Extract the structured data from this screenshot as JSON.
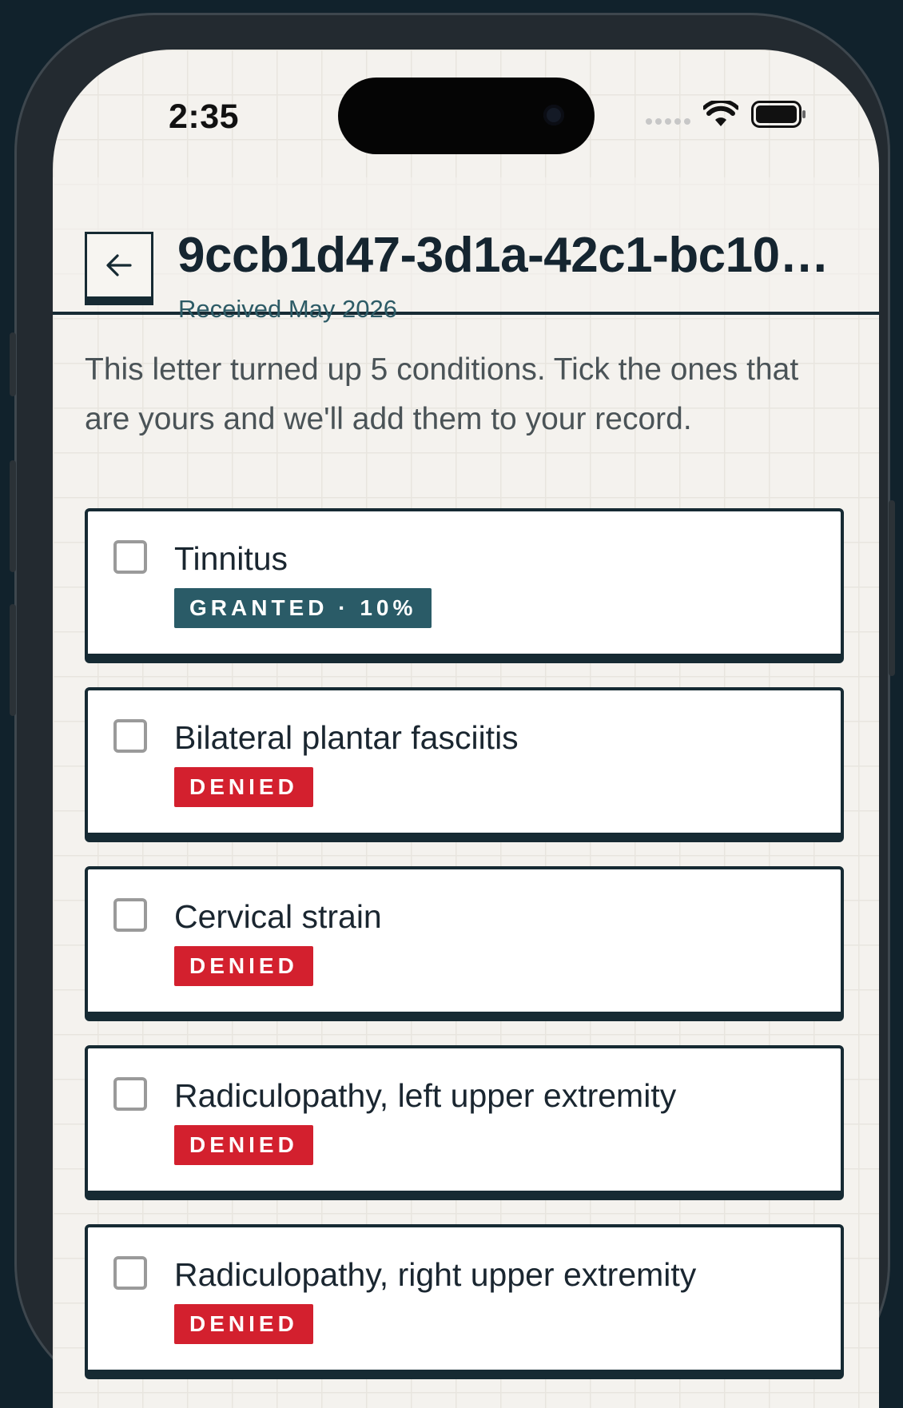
{
  "status_bar": {
    "time": "2:35",
    "icons": [
      "signal-dots-icon",
      "wifi-icon",
      "battery-icon"
    ]
  },
  "header": {
    "back_icon": "arrow-left-icon",
    "title": "9ccb1d47-3d1a-42c1-bc10…",
    "subtitle": "Received May 2026"
  },
  "intro": "This letter turned up 5 conditions. Tick the ones that are yours and we'll add them to your record.",
  "conditions": [
    {
      "name": "Tinnitus",
      "badge": "GRANTED · 10%",
      "status": "granted",
      "checked": false
    },
    {
      "name": "Bilateral plantar fasciitis",
      "badge": "DENIED",
      "status": "denied",
      "checked": false
    },
    {
      "name": "Cervical strain",
      "badge": "DENIED",
      "status": "denied",
      "checked": false
    },
    {
      "name": "Radiculopathy, left upper extremity",
      "badge": "DENIED",
      "status": "denied",
      "checked": false
    },
    {
      "name": "Radiculopathy, right upper extremity",
      "badge": "DENIED",
      "status": "denied",
      "checked": false
    }
  ],
  "colors": {
    "background": "#11222c",
    "screen": "#f4f2ee",
    "ink": "#162a33",
    "granted": "#2a5b67",
    "denied": "#d3202e"
  }
}
